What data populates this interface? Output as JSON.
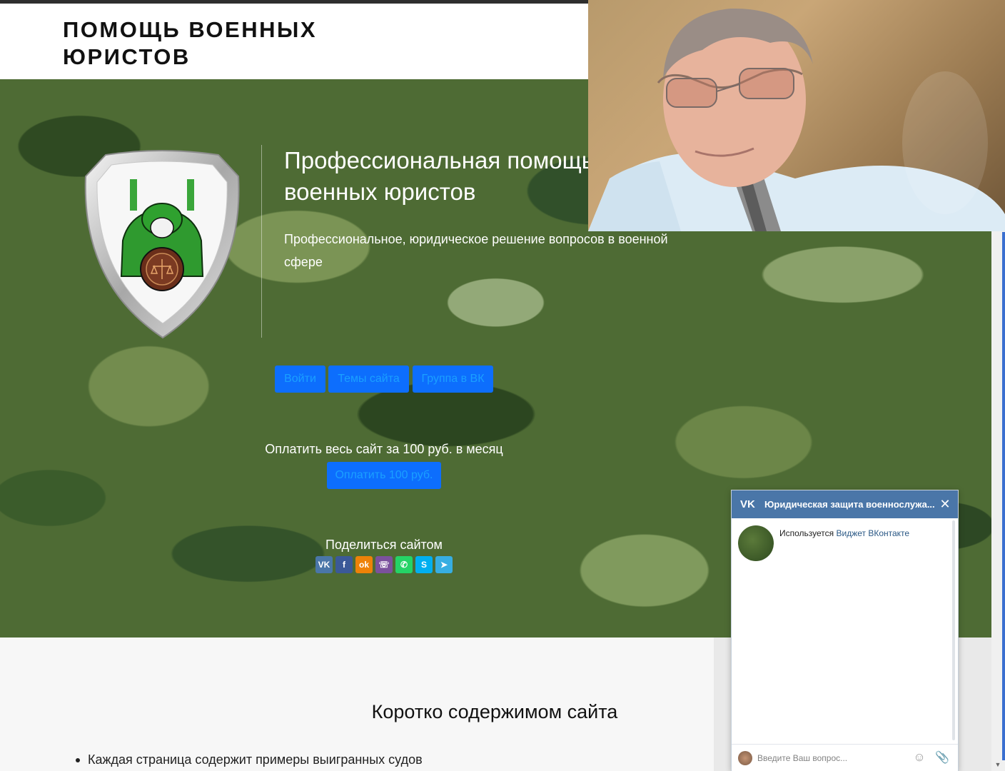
{
  "header": {
    "site_title": "ПОМОЩЬ ВОЕННЫХ ЮРИСТОВ"
  },
  "hero": {
    "heading": "Профессиональная помощь военных юристов",
    "subtitle": "Профессиональное, юридическое решение вопросов в военной сфере",
    "buttons": {
      "login": "Войти",
      "topics": "Темы сайта",
      "vk_group": "Группа в ВК"
    },
    "payment": {
      "text": "Оплатить весь сайт за 100 руб. в месяц",
      "button": "Оплатить 100 руб."
    },
    "share": {
      "label": "Поделиться сайтом",
      "icons": [
        "vk-icon",
        "facebook-icon",
        "odnoklassniki-icon",
        "viber-icon",
        "whatsapp-icon",
        "skype-icon",
        "telegram-icon"
      ]
    }
  },
  "content": {
    "title": "Коротко содержимом сайта",
    "bullets": [
      "Каждая страница содержит примеры выигранных судов"
    ]
  },
  "vk_widget": {
    "title": "Юридическая защита военнослужа...",
    "message_prefix": "Используется ",
    "message_link": "Виджет ВКонтакте",
    "input_placeholder": "Введите Ваш вопрос..."
  },
  "colors": {
    "button_bg": "#0d6efd",
    "button_text": "#1aa0ff",
    "vk_header": "#4a76a8",
    "share_vk": "#4a76a8",
    "share_facebook": "#3b5998",
    "share_ok": "#ee8208",
    "share_viber": "#7b519d",
    "share_whatsapp": "#25d366",
    "share_skype": "#00aff0",
    "share_telegram": "#37aee2"
  }
}
